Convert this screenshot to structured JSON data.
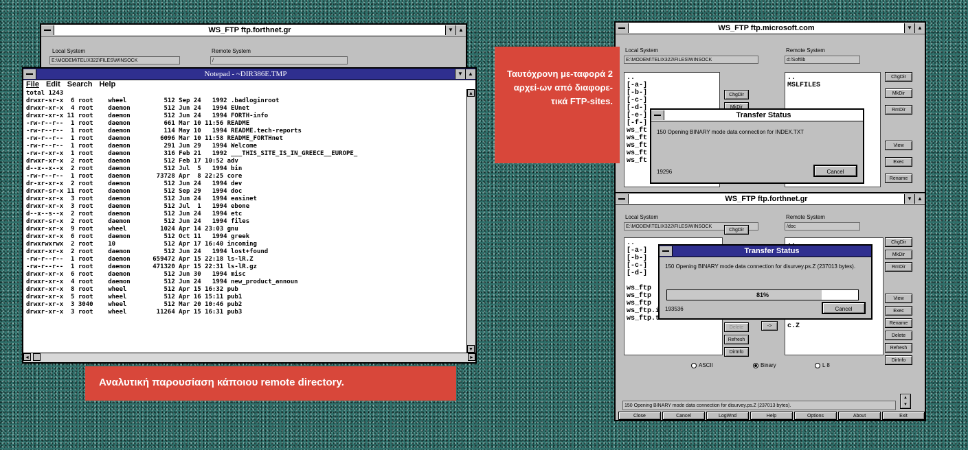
{
  "win_left_back": {
    "title": "WS_FTP ftp.forthnet.gr",
    "local_label": "Local System",
    "local_path": "E:\\MODEM\\TELIX322\\FILES\\WINSOCK",
    "remote_label": "Remote System",
    "remote_path": "/"
  },
  "notepad": {
    "title": "Notepad - ~DIR386E.TMP",
    "menu": [
      "File",
      "Edit",
      "Search",
      "Help"
    ],
    "lines": [
      "total 1243",
      "drwxr-sr-x  6 root    wheel          512 Sep 24   1992 .badloginroot",
      "drwxr-xr-x  4 root    daemon         512 Jun 24   1994 EUnet",
      "drwxr-xr-x 11 root    daemon         512 Jun 24   1994 FORTH-info",
      "-rw-r--r--  1 root    daemon         661 Mar 10 11:56 README",
      "-rw-r--r--  1 root    daemon         114 May 10   1994 README.tech-reports",
      "-rw-r--r--  1 root    daemon        6096 Mar 10 11:58 README_FORTHnet",
      "-rw-r--r--  1 root    daemon         291 Jun 29   1994 Welcome",
      "-rw-r-xr-x  1 root    daemon         316 Feb 21   1992 ___THIS_SITE_IS_IN_GREECE__EUROPE_",
      "drwxr-xr-x  2 root    daemon         512 Feb 17 10:52 adv",
      "d--x--x--x  2 root    daemon         512 Jul  5   1994 bin",
      "-rw-r--r--  1 root    daemon       73728 Apr  8 22:25 core",
      "dr-xr-xr-x  2 root    daemon         512 Jun 24   1994 dev",
      "drwxr-sr-x 11 root    daemon         512 Sep 29   1994 doc",
      "drwxr-xr-x  3 root    daemon         512 Jun 24   1994 easinet",
      "drwxr-xr-x  3 root    daemon         512 Jul  1   1994 ebone",
      "d--x--s--x  2 root    daemon         512 Jun 24   1994 etc",
      "drwxr-sr-x  2 root    daemon         512 Jun 24   1994 files",
      "drwxr-xr-x  9 root    wheel         1024 Apr 14 23:03 gnu",
      "drwxr-xr-x  6 root    daemon         512 Oct 11   1994 greek",
      "drwxrwxrwx  2 root    10             512 Apr 17 16:40 incoming",
      "drwxr-xr-x  2 root    daemon         512 Jun 24   1994 lost+found",
      "-rw-r--r--  1 root    daemon      659472 Apr 15 22:18 ls-lR.Z",
      "-rw-r--r--  1 root    daemon      471320 Apr 15 22:31 ls-lR.gz",
      "drwxr-xr-x  6 root    daemon         512 Jun 30   1994 misc",
      "drwxr-xr-x  4 root    daemon         512 Jun 24   1994 new_product_announ",
      "drwxr-xr-x  8 root    wheel          512 Apr 15 16:32 pub",
      "drwxr-xr-x  5 root    wheel          512 Apr 16 15:11 pub1",
      "drwxr-xr-x  3 3040    wheel          512 Mar 20 10:46 pub2",
      "drwxr-xr-x  3 root    wheel        11264 Apr 15 16:31 pub3"
    ]
  },
  "callout_left": "Αναλυτική παρουσίαση κάποιου remote directory.",
  "callout_right": "Ταυτόχρονη με-ταφορά 2 αρχεί-ων από διαφορε-τικά FTP-sites.",
  "win_ms": {
    "title": "WS_FTP ftp.microsoft.com",
    "local_label": "Local System",
    "local_path": "E:\\MODEM\\TELIX322\\FILES\\WINSOCK",
    "remote_label": "Remote System",
    "remote_path": "d:/Softlib",
    "local_items": [
      "..",
      "[-a-]",
      "[-b-]",
      "[-c-]",
      "[-d-]",
      "[-e-]",
      "[-f-]",
      "ws_ft",
      "ws_ft",
      "ws_ft",
      "ws_ft",
      "ws_ft"
    ],
    "remote_items": [
      "..",
      "MSLFILES"
    ],
    "local_buttons": [
      "ChgDir",
      "MkDir"
    ],
    "remote_buttons": [
      "ChgDir",
      "MkDir",
      "RmDir",
      "View",
      "Exec",
      "Rename"
    ],
    "dialog": {
      "title": "Transfer Status",
      "message": "150 Opening BINARY mode data connection for INDEX.TXT",
      "count": "19296",
      "cancel": "Cancel"
    }
  },
  "win_forth": {
    "title": "WS_FTP ftp.forthnet.gr",
    "local_label": "Local System",
    "local_path": "E:\\MODEM\\TELIX322\\FILES\\WINSOCK",
    "remote_label": "Remote System",
    "remote_path": "/doc",
    "local_items": [
      "..",
      "[-a-]",
      "[-b-]",
      "[-c-]",
      "[-d-]",
      "",
      "ws_ftp",
      "ws_ftp",
      "ws_ftp",
      "ws_ftp.ini",
      "ws_ftp.txt"
    ],
    "remote_items": [
      "..",
      "",
      "",
      "",
      "",
      "",
      "",
      "",
      "",
      ".Z",
      "c.tar.Z",
      "c.Z"
    ],
    "local_buttons": [
      "ChgDir",
      "Rename",
      "Delete",
      "Refresh",
      "DirInfo"
    ],
    "remote_buttons": [
      "ChgDir",
      "MkDir",
      "RmDir",
      "View",
      "Exec",
      "Rename",
      "Delete",
      "Refresh",
      "DirInfo"
    ],
    "arrow_right": "->",
    "radio": [
      "ASCII",
      "Binary",
      "L 8"
    ],
    "status": "150 Opening BINARY mode data connection for disurvey.ps.Z (237013 bytes).",
    "bottom_buttons": [
      "Close",
      "Cancel",
      "LogWnd",
      "Help",
      "Options",
      "About",
      "Exit"
    ],
    "dialog": {
      "title": "Transfer Status",
      "message": "150 Opening BINARY mode data connection for disurvey.ps.Z (237013 bytes).",
      "progress_percent": 81,
      "progress_label": "81%",
      "count": "193536",
      "cancel": "Cancel"
    }
  }
}
